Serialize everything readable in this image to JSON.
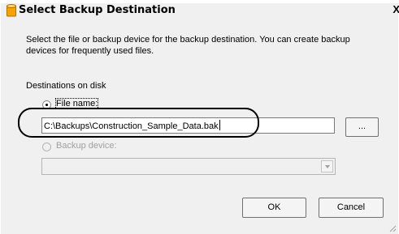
{
  "window": {
    "title": "Select Backup Destination",
    "close_glyph": "X",
    "title_icon": "database-icon"
  },
  "description": "Select the file or backup device for the backup destination. You can create backup devices for frequently used files.",
  "destinations": {
    "group_label": "Destinations on disk",
    "file_name": {
      "label": "File name:",
      "selected": true,
      "value": "C:\\Backups\\Construction_Sample_Data.bak"
    },
    "browse_label": "...",
    "backup_device": {
      "label": "Backup device:",
      "selected": false,
      "enabled": false,
      "value": ""
    }
  },
  "buttons": {
    "ok": "OK",
    "cancel": "Cancel"
  }
}
